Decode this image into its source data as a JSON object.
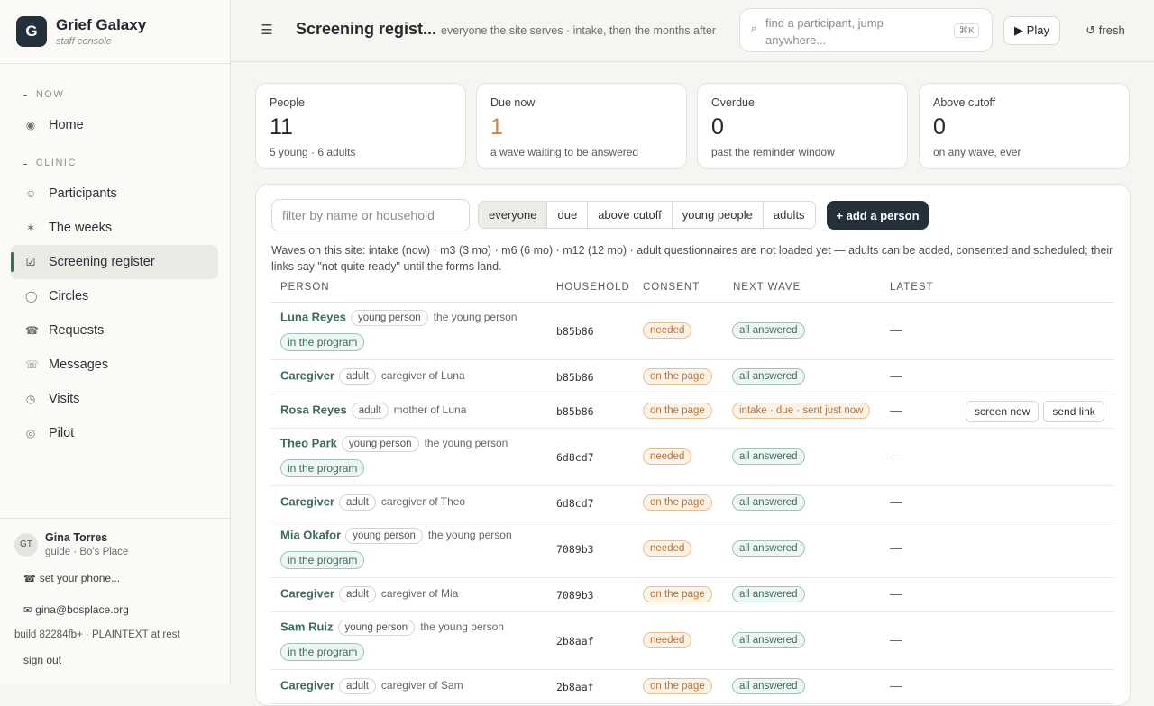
{
  "brand": {
    "logo": "G",
    "name": "Grief Galaxy",
    "sub": "staff console"
  },
  "nav": {
    "section_now": "NOW",
    "section_clinic": "CLINIC",
    "items": [
      {
        "label": "Home",
        "icon": "◉"
      },
      {
        "label": "Participants",
        "icon": "☺"
      },
      {
        "label": "The weeks",
        "icon": "✶"
      },
      {
        "label": "Screening register",
        "icon": "☑"
      },
      {
        "label": "Circles",
        "icon": "◯"
      },
      {
        "label": "Requests",
        "icon": "☎"
      },
      {
        "label": "Messages",
        "icon": "☏"
      },
      {
        "label": "Visits",
        "icon": "◷"
      },
      {
        "label": "Pilot",
        "icon": "◎"
      }
    ]
  },
  "user": {
    "initials": "GT",
    "name": "Gina Torres",
    "role": "guide · Bo's Place",
    "phone": "set your phone...",
    "email": "gina@bosplace.org",
    "build": "build 82284fb+ · PLAINTEXT at rest",
    "signout": "sign out"
  },
  "header": {
    "menu_icon": "☰",
    "title": "Screening regist...",
    "subtitle": "everyone the site serves · intake, then the months after",
    "search_placeholder": "find a participant, jump anywhere...",
    "search_kbd": "⌘K",
    "play": "▶ Play",
    "fresh": "↺ fresh"
  },
  "stats": [
    {
      "label": "People",
      "value": "11",
      "foot": "5 young · 6 adults"
    },
    {
      "label": "Due now",
      "value": "1",
      "foot": "a wave waiting to be answered"
    },
    {
      "label": "Overdue",
      "value": "0",
      "foot": "past the reminder window"
    },
    {
      "label": "Above cutoff",
      "value": "0",
      "foot": "on any wave, ever"
    }
  ],
  "filter": {
    "placeholder": "filter by name or household",
    "segments": [
      "everyone",
      "due",
      "above cutoff",
      "young people",
      "adults"
    ],
    "add_button": "+ add a person"
  },
  "note": "Waves on this site: intake (now) · m3 (3 mo) · m6 (6 mo) · m12 (12 mo) · adult questionnaires are not loaded yet — adults can be added, consented and scheduled; their links say \"not quite ready\" until the forms land.",
  "table": {
    "columns": [
      "PERSON",
      "HOUSEHOLD",
      "CONSENT",
      "NEXT WAVE",
      "LATEST"
    ],
    "rows": [
      {
        "name": "Luna Reyes",
        "kind": "young person",
        "relation": "the young person",
        "program": "in the program",
        "household": "b85b86",
        "consent": "needed",
        "wave": "all answered",
        "latest": "—"
      },
      {
        "name": "Caregiver",
        "kind": "adult",
        "relation": "caregiver of Luna",
        "household": "b85b86",
        "consent": "on the page",
        "wave": "all answered",
        "latest": "—"
      },
      {
        "name": "Rosa Reyes",
        "kind": "adult",
        "relation": "mother of Luna",
        "household": "b85b86",
        "consent": "on the page",
        "wave": "intake · due · sent just now",
        "latest": "—",
        "actions": [
          "screen now",
          "send link"
        ]
      },
      {
        "name": "Theo Park",
        "kind": "young person",
        "relation": "the young person",
        "program": "in the program",
        "household": "6d8cd7",
        "consent": "needed",
        "wave": "all answered",
        "latest": "—"
      },
      {
        "name": "Caregiver",
        "kind": "adult",
        "relation": "caregiver of Theo",
        "household": "6d8cd7",
        "consent": "on the page",
        "wave": "all answered",
        "latest": "—"
      },
      {
        "name": "Mia Okafor",
        "kind": "young person",
        "relation": "the young person",
        "program": "in the program",
        "household": "7089b3",
        "consent": "needed",
        "wave": "all answered",
        "latest": "—"
      },
      {
        "name": "Caregiver",
        "kind": "adult",
        "relation": "caregiver of Mia",
        "household": "7089b3",
        "consent": "on the page",
        "wave": "all answered",
        "latest": "—"
      },
      {
        "name": "Sam Ruiz",
        "kind": "young person",
        "relation": "the young person",
        "program": "in the program",
        "household": "2b8aaf",
        "consent": "needed",
        "wave": "all answered",
        "latest": "—"
      },
      {
        "name": "Caregiver",
        "kind": "adult",
        "relation": "caregiver of Sam",
        "household": "2b8aaf",
        "consent": "on the page",
        "wave": "all answered",
        "latest": "—"
      }
    ]
  }
}
